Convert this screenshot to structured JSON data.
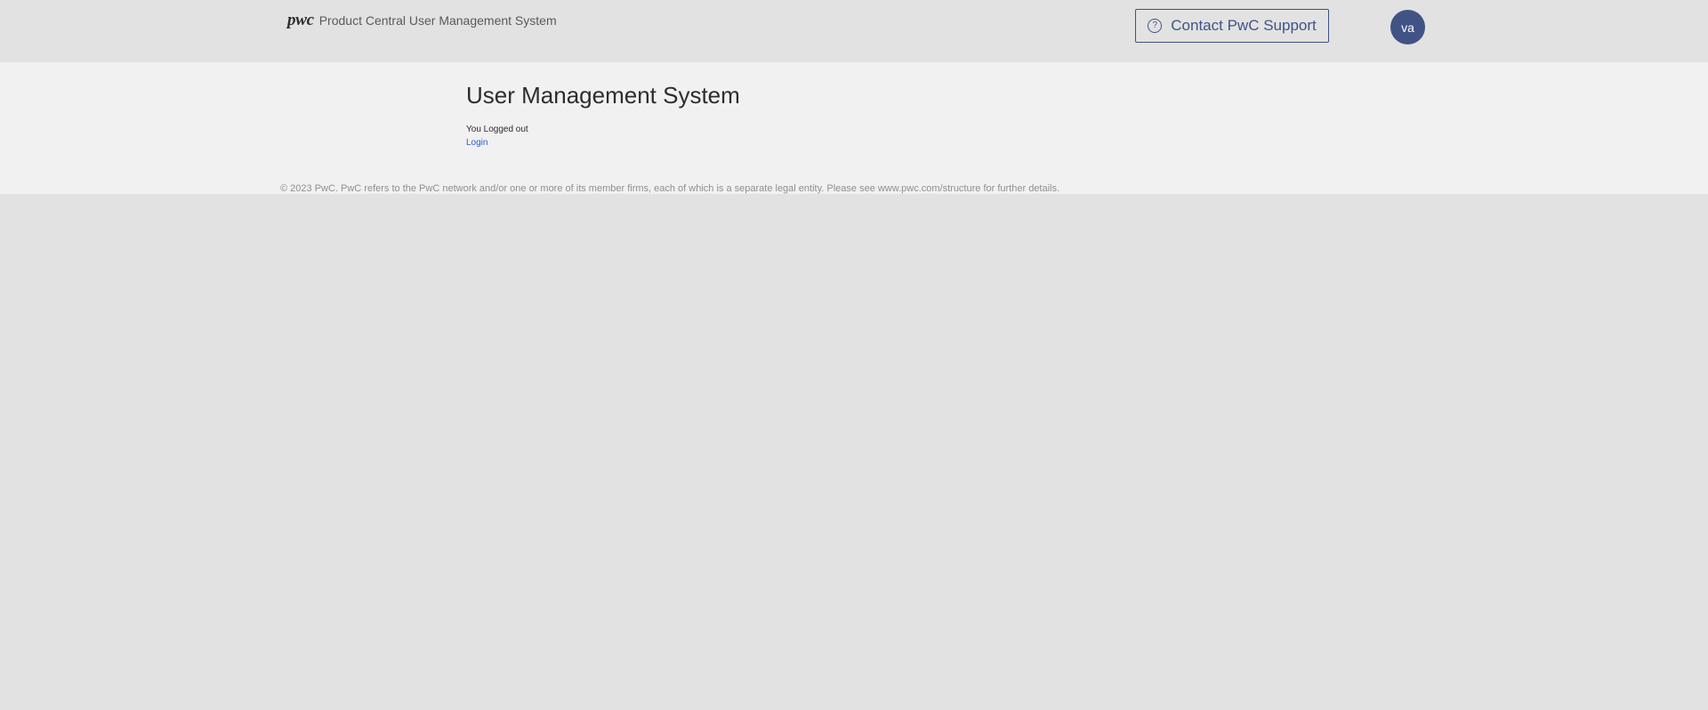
{
  "header": {
    "logo_text": "pwc",
    "app_title": "Product Central User Management System",
    "support_button_label": "Contact PwC Support",
    "help_icon_glyph": "?",
    "avatar_initials": "va",
    "accent_color": "#415385"
  },
  "main": {
    "page_title": "User Management System",
    "status_message": "You Logged out",
    "login_link_label": "Login",
    "link_color": "#2a5bd7"
  },
  "footer": {
    "copyright": "© 2023 PwC. PwC refers to the PwC network and/or one or more of its member firms, each of which is a separate legal entity. Please see www.pwc.com/structure for further details."
  }
}
